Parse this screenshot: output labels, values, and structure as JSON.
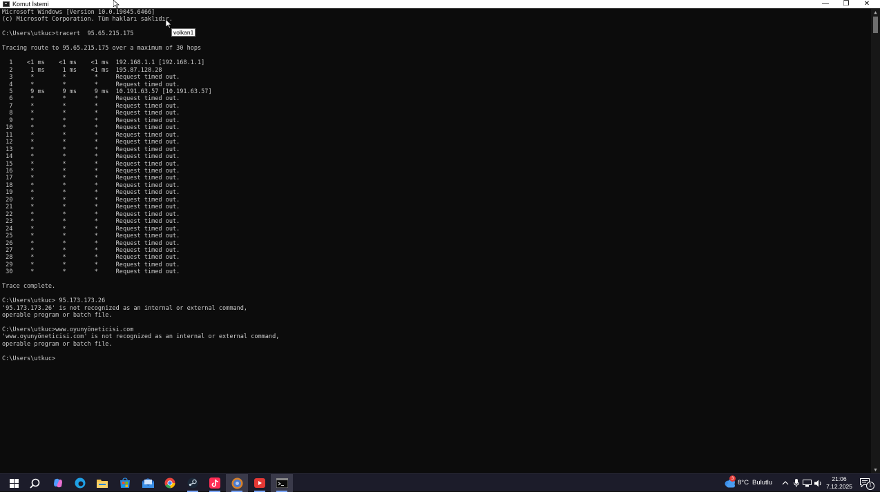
{
  "window": {
    "title": "Komut İstemi",
    "minimize_label": "—",
    "maximize_label": "❐",
    "close_label": "✕"
  },
  "console": {
    "lines": [
      "Microsoft Windows [Version 10.0.19045.6466]",
      "(c) Microsoft Corporation. Tüm hakları saklıdır.",
      "",
      "C:\\Users\\utkuc>tracert  95.65.215.175",
      "",
      "Tracing route to 95.65.215.175 over a maximum of 30 hops",
      "",
      "  1    <1 ms    <1 ms    <1 ms  192.168.1.1 [192.168.1.1]",
      "  2     1 ms     1 ms    <1 ms  195.87.128.28",
      "  3     *        *        *     Request timed out.",
      "  4     *        *        *     Request timed out.",
      "  5     9 ms     9 ms     9 ms  10.191.63.57 [10.191.63.57]",
      "  6     *        *        *     Request timed out.",
      "  7     *        *        *     Request timed out.",
      "  8     *        *        *     Request timed out.",
      "  9     *        *        *     Request timed out.",
      " 10     *        *        *     Request timed out.",
      " 11     *        *        *     Request timed out.",
      " 12     *        *        *     Request timed out.",
      " 13     *        *        *     Request timed out.",
      " 14     *        *        *     Request timed out.",
      " 15     *        *        *     Request timed out.",
      " 16     *        *        *     Request timed out.",
      " 17     *        *        *     Request timed out.",
      " 18     *        *        *     Request timed out.",
      " 19     *        *        *     Request timed out.",
      " 20     *        *        *     Request timed out.",
      " 21     *        *        *     Request timed out.",
      " 22     *        *        *     Request timed out.",
      " 23     *        *        *     Request timed out.",
      " 24     *        *        *     Request timed out.",
      " 25     *        *        *     Request timed out.",
      " 26     *        *        *     Request timed out.",
      " 27     *        *        *     Request timed out.",
      " 28     *        *        *     Request timed out.",
      " 29     *        *        *     Request timed out.",
      " 30     *        *        *     Request timed out.",
      "",
      "Trace complete.",
      "",
      "C:\\Users\\utkuc> 95.173.173.26",
      "'95.173.173.26' is not recognized as an internal or external command,",
      "operable program or batch file.",
      "",
      "C:\\Users\\utkuc>www.oyunyöneticisi.com",
      "'www.oyunyöneticisi.com' is not recognized as an internal or external command,",
      "operable program or batch file.",
      "",
      "C:\\Users\\utkuc>"
    ]
  },
  "tooltip": {
    "text": "volkan1"
  },
  "taskbar": {
    "icons": [
      {
        "name": "start-icon",
        "color": "#ffffff"
      },
      {
        "name": "search-icon",
        "color": "#ffffff"
      },
      {
        "name": "copilot-icon",
        "color": "#4f9cff"
      },
      {
        "name": "edge-icon",
        "color": "#1fa0e6"
      },
      {
        "name": "file-explorer-icon",
        "color": "#f4c34d"
      },
      {
        "name": "microsoft-store-icon",
        "color": "#2b88d8"
      },
      {
        "name": "mail-icon",
        "color": "#3a7bd5"
      },
      {
        "name": "chrome-icon",
        "color": "#e8453c"
      },
      {
        "name": "steam-icon",
        "color": "#c7d5e0"
      },
      {
        "name": "tiktok-icon",
        "color": "#ff2d55"
      },
      {
        "name": "app-circle-icon",
        "color": "#4a7bd0"
      },
      {
        "name": "media-app-icon",
        "color": "#e53935"
      },
      {
        "name": "terminal-icon",
        "color": "#cccccc"
      }
    ],
    "weather": {
      "temp": "8°C",
      "condition": "Bulutlu",
      "badge": "3"
    },
    "clock": {
      "time": "21:06",
      "date": "7.12.2025"
    },
    "notification_badge": "1"
  }
}
